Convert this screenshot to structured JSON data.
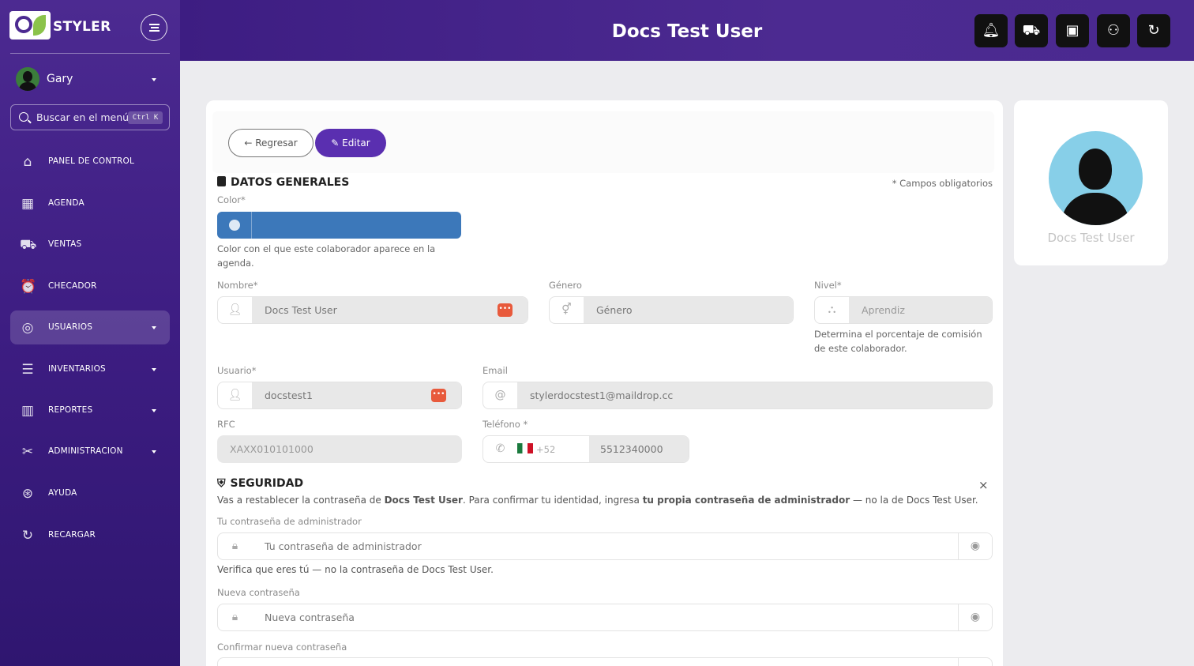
{
  "app": {
    "brand": "STYLER"
  },
  "sidebar": {
    "user_name": "Gary",
    "search_placeholder": "Buscar en el menú",
    "search_shortcut": "Ctrl K",
    "items": [
      {
        "label": "PANEL DE CONTROL",
        "icon": "store-icon"
      },
      {
        "label": "AGENDA",
        "icon": "calendar-icon"
      },
      {
        "label": "VENTAS",
        "icon": "cart-icon"
      },
      {
        "label": "CHECADOR",
        "icon": "alarm-clock-icon"
      },
      {
        "label": "USUARIOS",
        "icon": "user-circle-icon",
        "active": true
      },
      {
        "label": "INVENTARIOS",
        "icon": "list-icon"
      },
      {
        "label": "REPORTES",
        "icon": "bar-chart-icon"
      },
      {
        "label": "ADMINISTRACION",
        "icon": "tools-icon"
      },
      {
        "label": "AYUDA",
        "icon": "help-icon"
      },
      {
        "label": "RECARGAR",
        "icon": "reload-icon"
      }
    ]
  },
  "header": {
    "title": "Docs Test User",
    "buttons": [
      "bell-icon",
      "cart-icon",
      "calendar-plus-icon",
      "user-plus-icon",
      "refresh-icon"
    ]
  },
  "actions": {
    "back": "Regresar",
    "edit": "Editar"
  },
  "general": {
    "title": "DATOS GENERALES",
    "required_note": "* Campos obligatorios",
    "color_label": "Color*",
    "color_value": "#3c78ba",
    "color_help": "Color con el que este colaborador aparece en la agenda.",
    "nombre_label": "Nombre*",
    "nombre_value": "Docs Test User",
    "genero_label": "Género",
    "genero_placeholder": "Género",
    "nivel_label": "Nivel*",
    "nivel_value": "Aprendiz",
    "nivel_help": "Determina el porcentaje de comisión de este colaborador.",
    "usuario_label": "Usuario*",
    "usuario_value": "docstest1",
    "email_label": "Email",
    "email_value": "stylerdocstest1@maildrop.cc",
    "rfc_label": "RFC",
    "rfc_value": "XAXX010101000",
    "telefono_label": "Teléfono *",
    "telefono_code": "+52",
    "telefono_value": "5512340000"
  },
  "security": {
    "title": "SEGURIDAD",
    "notice_1": "Vas a restablecer la contraseña de ",
    "notice_name": "Docs Test User",
    "notice_2": ". Para confirmar tu identidad, ingresa ",
    "notice_bold": "tu propia contraseña de administrador",
    "notice_3": " — no la de Docs Test User.",
    "admin_label": "Tu contraseña de administrador",
    "admin_placeholder": "Tu contraseña de administrador",
    "admin_help": "Verifica que eres tú — no la contraseña de Docs Test User.",
    "new_label": "Nueva contraseña",
    "new_placeholder": "Nueva contraseña",
    "confirm_label": "Confirmar nueva contraseña"
  },
  "profile": {
    "name": "Docs Test User"
  }
}
